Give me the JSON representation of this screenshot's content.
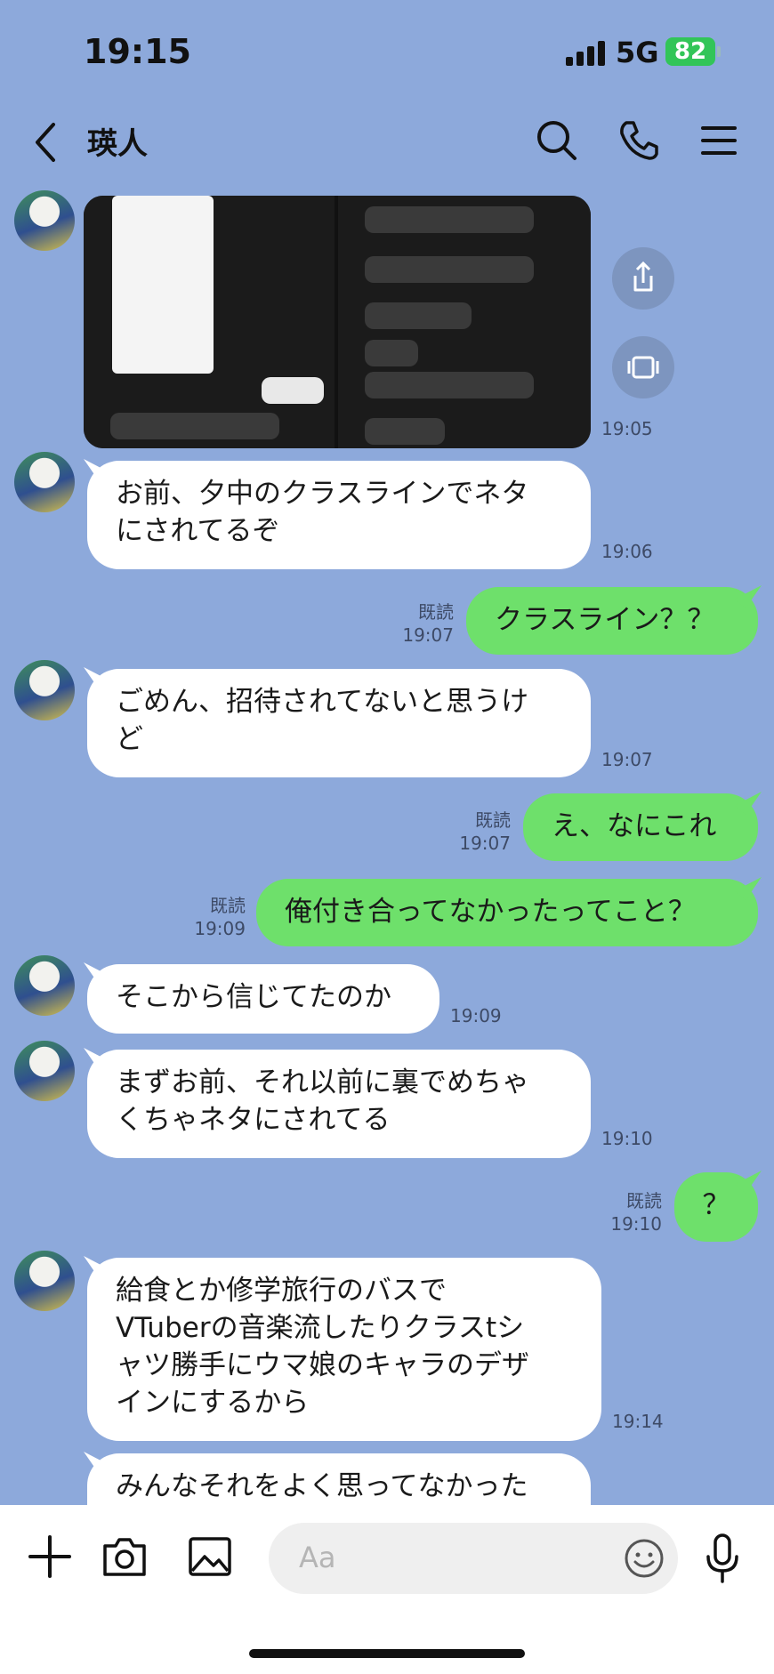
{
  "status_bar": {
    "time": "19:15",
    "network": "5G",
    "battery": "82"
  },
  "header": {
    "contact_name": "瑛人"
  },
  "messages": [
    {
      "id": "m1",
      "type": "image",
      "time": "19:05"
    },
    {
      "id": "m2",
      "side": "in",
      "lines": [
        "お前、夕中のクラスラインでネタ",
        "にされてるぞ"
      ],
      "time": "19:06"
    },
    {
      "id": "m3",
      "side": "out",
      "text": "クラスライン？？",
      "read": "既読",
      "time": "19:07"
    },
    {
      "id": "m4",
      "side": "in",
      "lines": [
        "ごめん、招待されてないと思うけ",
        "ど"
      ],
      "time": "19:07"
    },
    {
      "id": "m5",
      "side": "out",
      "text": "え、なにこれ",
      "read": "既読",
      "time": "19:07"
    },
    {
      "id": "m6",
      "side": "out",
      "text": "俺付き合ってなかったってこと？",
      "read": "既読",
      "time": "19:09"
    },
    {
      "id": "m7",
      "side": "in",
      "lines": [
        "そこから信じてたのか"
      ],
      "time": "19:09"
    },
    {
      "id": "m8",
      "side": "in",
      "lines": [
        "まずお前、それ以前に裏でめちゃ",
        "くちゃネタにされてる"
      ],
      "time": "19:10"
    },
    {
      "id": "m9",
      "side": "out",
      "text": "？",
      "read": "既読",
      "time": "19:10"
    },
    {
      "id": "m10",
      "side": "in",
      "lines": [
        "給食とか修学旅行のバスで",
        "VTuberの音楽流したりクラスtシ",
        "ャツ勝手にウマ娘のキャラのデザ",
        "インにするから"
      ],
      "time": "19:14"
    },
    {
      "id": "m11",
      "side": "in",
      "lines": [
        "みんなそれをよく思ってなかった"
      ]
    }
  ],
  "input": {
    "placeholder": "Aa"
  },
  "icons": {
    "back": "chevron-left-icon",
    "search": "search-icon",
    "call": "phone-icon",
    "menu": "menu-icon",
    "share": "share-icon",
    "keep": "keep-icon",
    "add": "plus-icon",
    "camera": "camera-icon",
    "image": "image-icon",
    "emoji": "emoji-icon",
    "mic": "mic-icon"
  },
  "colors": {
    "background": "#8DA9DB",
    "outgoing": "#6EE06B",
    "incoming": "#FFFFFF",
    "battery": "#32C558"
  }
}
